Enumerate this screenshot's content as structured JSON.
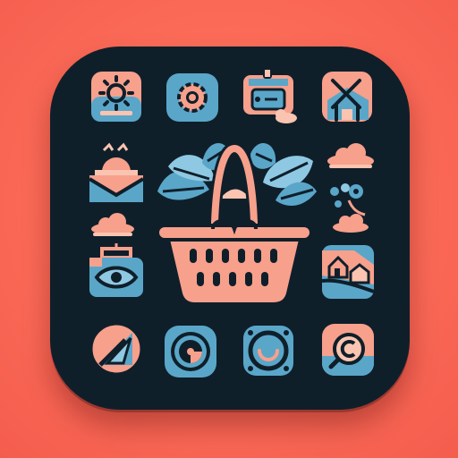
{
  "app_icon": {
    "colors": {
      "background": "#fb6a57",
      "tile": "#0f1f2a",
      "salmon": "#f7a08c",
      "peach": "#fbc4b0",
      "blue": "#5aa6c9",
      "light_blue": "#8fc8e3",
      "dark": "#0f1f2a"
    },
    "icons": [
      "sun-icon",
      "gear-icon",
      "notebook-icon",
      "map-icon",
      "sunset-icon",
      "cloud-icon",
      "plant-leaves-icon",
      "shopping-basket-icon",
      "paw-icon",
      "cloud-icon",
      "photo-eye-icon",
      "landscape-icon",
      "compass-icon",
      "vinyl-icon",
      "smile-icon",
      "search-icon"
    ]
  }
}
